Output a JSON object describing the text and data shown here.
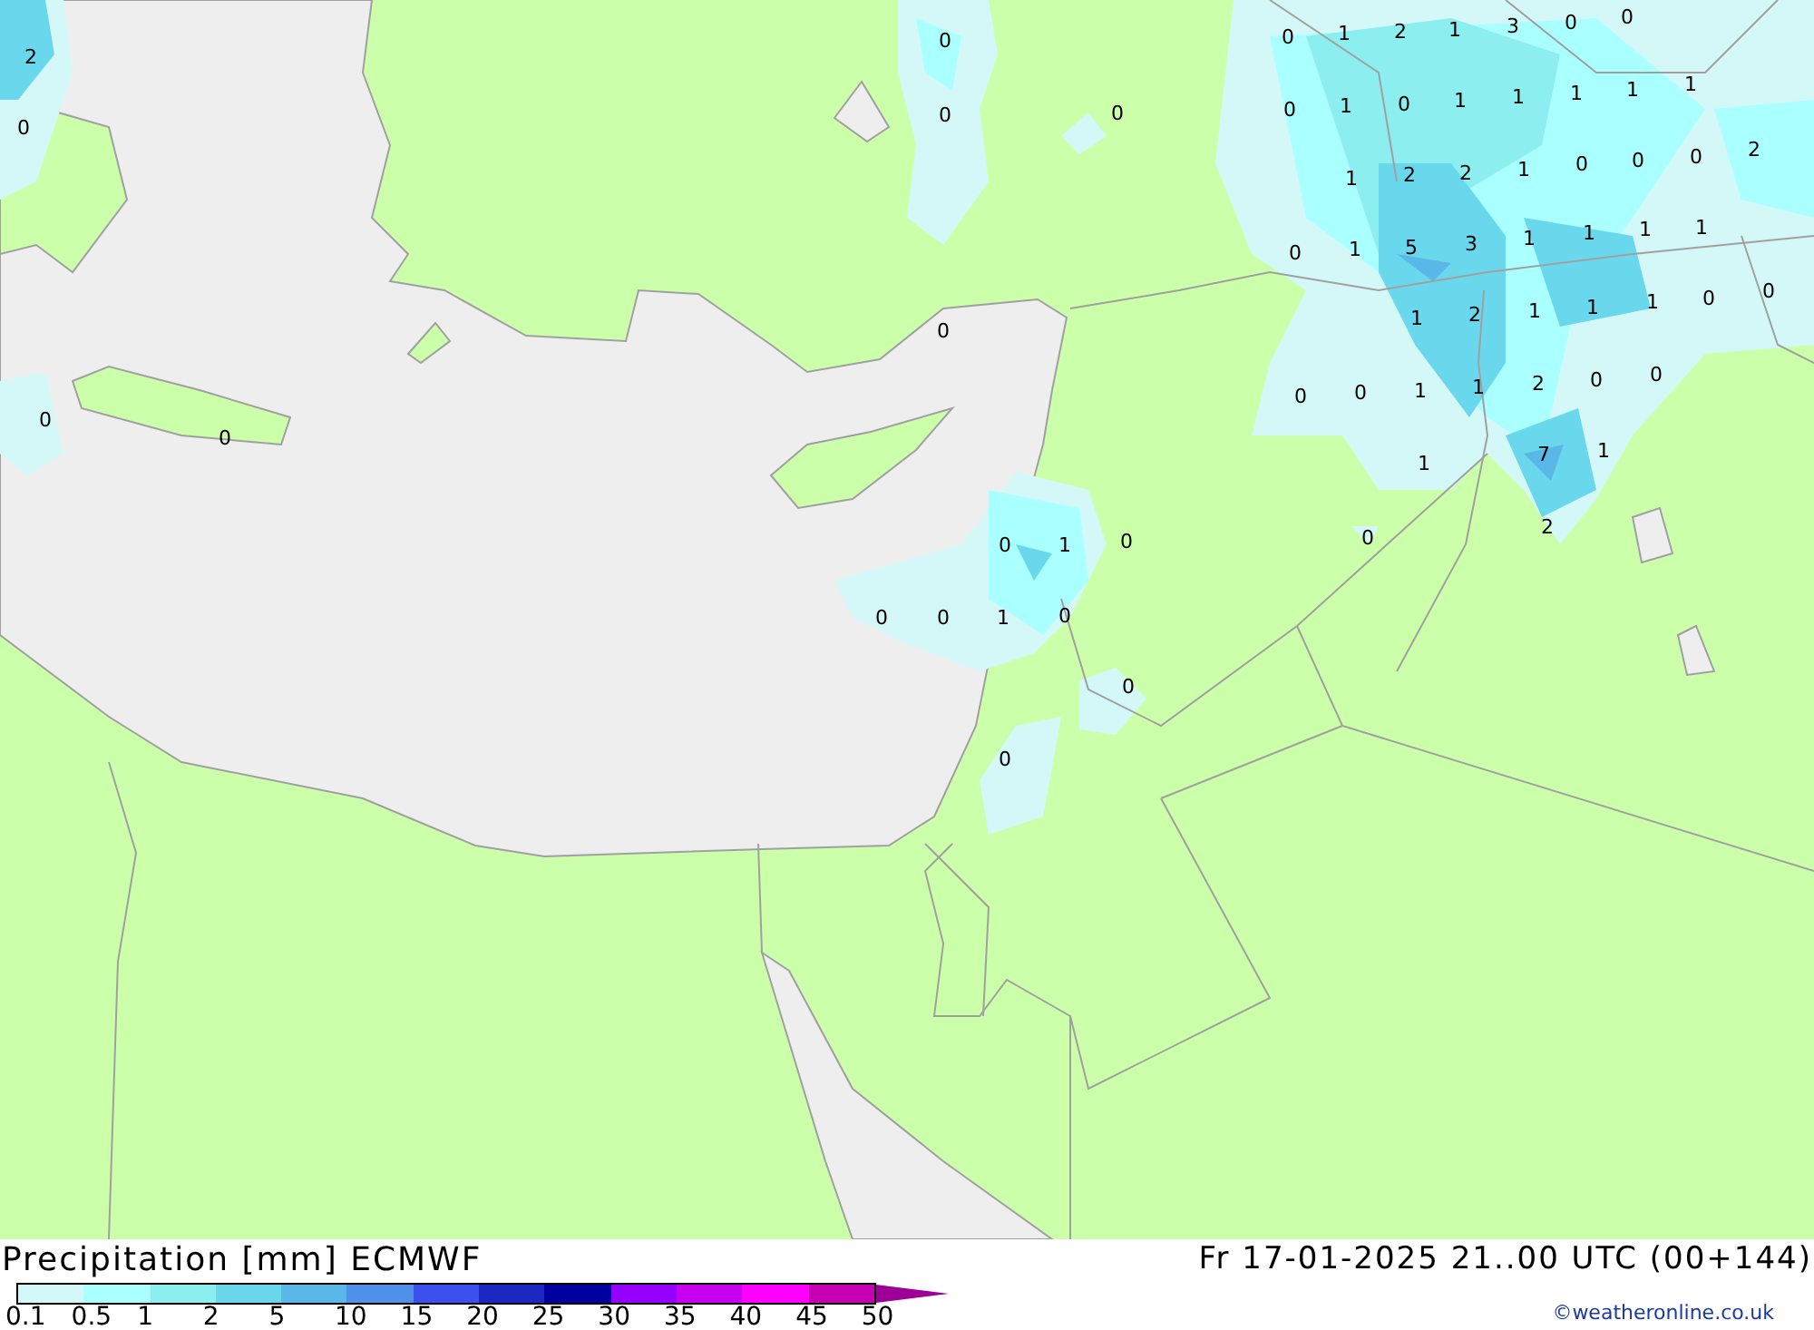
{
  "map": {
    "values": [
      "2",
      "0",
      "0",
      "0",
      "0",
      "0",
      "0",
      "0",
      "0",
      "1",
      "2",
      "1",
      "3",
      "0",
      "0",
      "0",
      "1",
      "0",
      "1",
      "1",
      "1",
      "1",
      "1",
      "1",
      "2",
      "2",
      "1",
      "0",
      "0",
      "0",
      "2",
      "0",
      "1",
      "5",
      "3",
      "1",
      "1",
      "1",
      "1",
      "1",
      "2",
      "1",
      "1",
      "1",
      "0",
      "0",
      "0",
      "0",
      "1",
      "1",
      "2",
      "0",
      "0",
      "1",
      "7",
      "1",
      "2",
      "0",
      "0",
      "1",
      "0",
      "0",
      "0",
      "1",
      "0",
      "0",
      "0"
    ]
  },
  "title": "Precipitation [mm] ECMWF",
  "valid_time": "Fr 17-01-2025 21..00 UTC (00+144)",
  "legend": {
    "bins": [
      {
        "color": "#d4f8f8"
      },
      {
        "color": "#aaffff"
      },
      {
        "color": "#8ceeee"
      },
      {
        "color": "#6ad8ec"
      },
      {
        "color": "#5ab8e8"
      },
      {
        "color": "#5090e8"
      },
      {
        "color": "#3c50f0"
      },
      {
        "color": "#1c28c0"
      },
      {
        "color": "#0000a0"
      },
      {
        "color": "#9600ff"
      },
      {
        "color": "#c800f0"
      },
      {
        "color": "#ff00ff"
      },
      {
        "color": "#c800b4"
      }
    ],
    "labels": [
      "0.1",
      "0.5",
      "1",
      "2",
      "5",
      "10",
      "15",
      "20",
      "25",
      "30",
      "35",
      "40",
      "45",
      "50"
    ]
  },
  "credit": "©weatheronline.co.uk"
}
